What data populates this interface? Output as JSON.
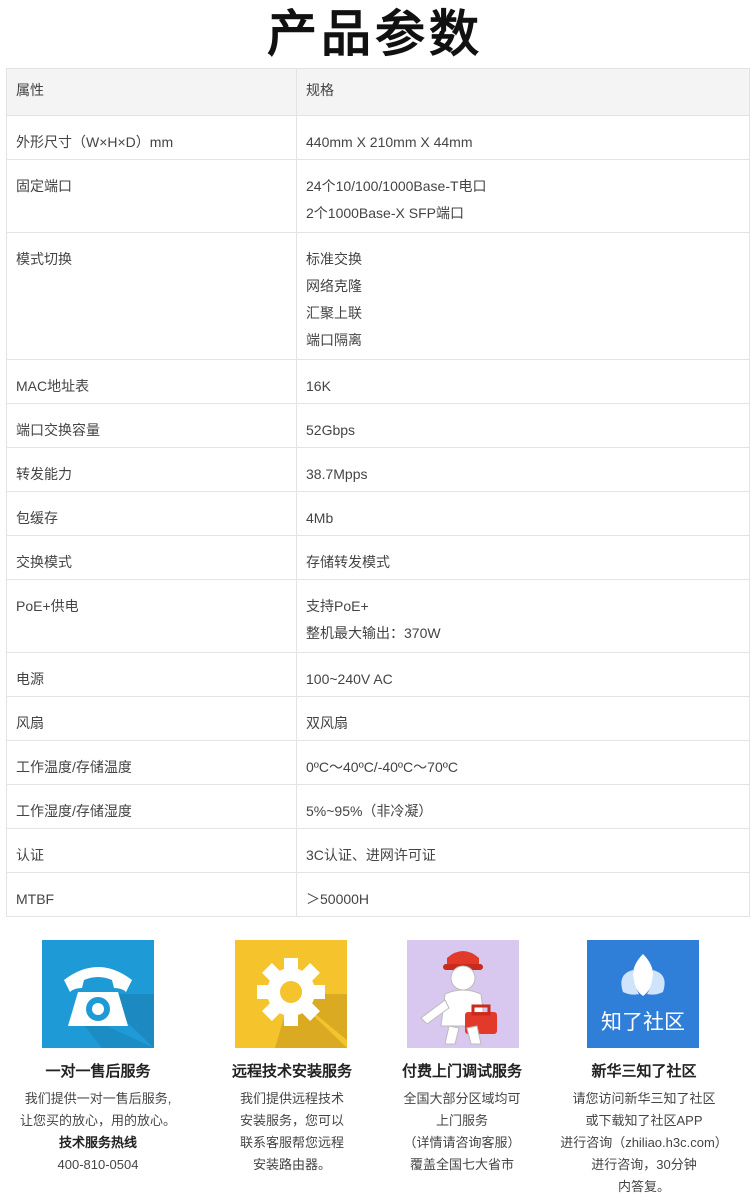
{
  "page_title": "产品参数",
  "table": {
    "header": {
      "attr": "属性",
      "val": "规格"
    },
    "rows": [
      {
        "attr": "外形尺寸（W×H×D）mm",
        "val": [
          "440mm X 210mm X 44mm"
        ]
      },
      {
        "attr": "固定端口",
        "val": [
          "24个10/100/1000Base-T电口",
          "2个1000Base-X SFP端口"
        ]
      },
      {
        "attr": "模式切换",
        "val": [
          "标准交换",
          "网络克隆",
          "汇聚上联",
          "端口隔离"
        ]
      },
      {
        "attr": "MAC地址表",
        "val": [
          "16K"
        ]
      },
      {
        "attr": "端口交换容量",
        "val": [
          "52Gbps"
        ]
      },
      {
        "attr": "转发能力",
        "val": [
          "38.7Mpps"
        ]
      },
      {
        "attr": "包缓存",
        "val": [
          "4Mb"
        ]
      },
      {
        "attr": "交换模式",
        "val": [
          "存储转发模式"
        ]
      },
      {
        "attr": "PoE+供电",
        "val": [
          "支持PoE+",
          "整机最大输出：370W"
        ]
      },
      {
        "attr": "电源",
        "val": [
          "100~240V AC"
        ]
      },
      {
        "attr": "风扇",
        "val": [
          "双风扇"
        ]
      },
      {
        "attr": "工作温度/存储温度",
        "val": [
          "0ºC～40ºC/-40ºC～70ºC"
        ]
      },
      {
        "attr": "工作湿度/存储湿度",
        "val": [
          "5%~95%（非冷凝）"
        ]
      },
      {
        "attr": "认证",
        "val": [
          "3C认证、进网许可证"
        ]
      },
      {
        "attr": "MTBF",
        "val": [
          "＞50000H"
        ]
      }
    ]
  },
  "services": [
    {
      "icon": "telephone-icon",
      "icon_bg": "#1e9ad6",
      "title": "一对一售后服务",
      "lines": [
        {
          "text": "我们提供一对一售后服务,",
          "bold": false
        },
        {
          "text": "让您买的放心，用的放心。",
          "bold": false
        },
        {
          "text": "技术服务热线",
          "bold": true
        },
        {
          "text": "400-810-0504",
          "bold": false
        }
      ]
    },
    {
      "icon": "gear-icon",
      "icon_bg": "#f5c32c",
      "title": "远程技术安装服务",
      "lines": [
        {
          "text": "我们提供远程技术",
          "bold": false
        },
        {
          "text": "安装服务，您可以",
          "bold": false
        },
        {
          "text": "联系客服帮您远程",
          "bold": false
        },
        {
          "text": "安装路由器。",
          "bold": false
        }
      ]
    },
    {
      "icon": "technician-icon",
      "icon_bg": "#d8c8f0",
      "title": "付费上门调试服务",
      "lines": [
        {
          "text": "全国大部分区域均可",
          "bold": false
        },
        {
          "text": "上门服务",
          "bold": false
        },
        {
          "text": "（详情请咨询客服）",
          "bold": false
        },
        {
          "text": "覆盖全国七大省市",
          "bold": false
        }
      ]
    },
    {
      "icon": "cicada-logo-icon",
      "icon_bg": "#2f7fd8",
      "icon_text": "知了社区",
      "title": "新华三知了社区",
      "lines": [
        {
          "text": "请您访问新华三知了社区",
          "bold": false
        },
        {
          "text": "或下载知了社区APP",
          "bold": false
        },
        {
          "text": "进行咨询（zhiliao.h3c.com）",
          "bold": false
        },
        {
          "text": "进行咨询，30分钟",
          "bold": false
        },
        {
          "text": "内答复。",
          "bold": false
        }
      ]
    }
  ]
}
